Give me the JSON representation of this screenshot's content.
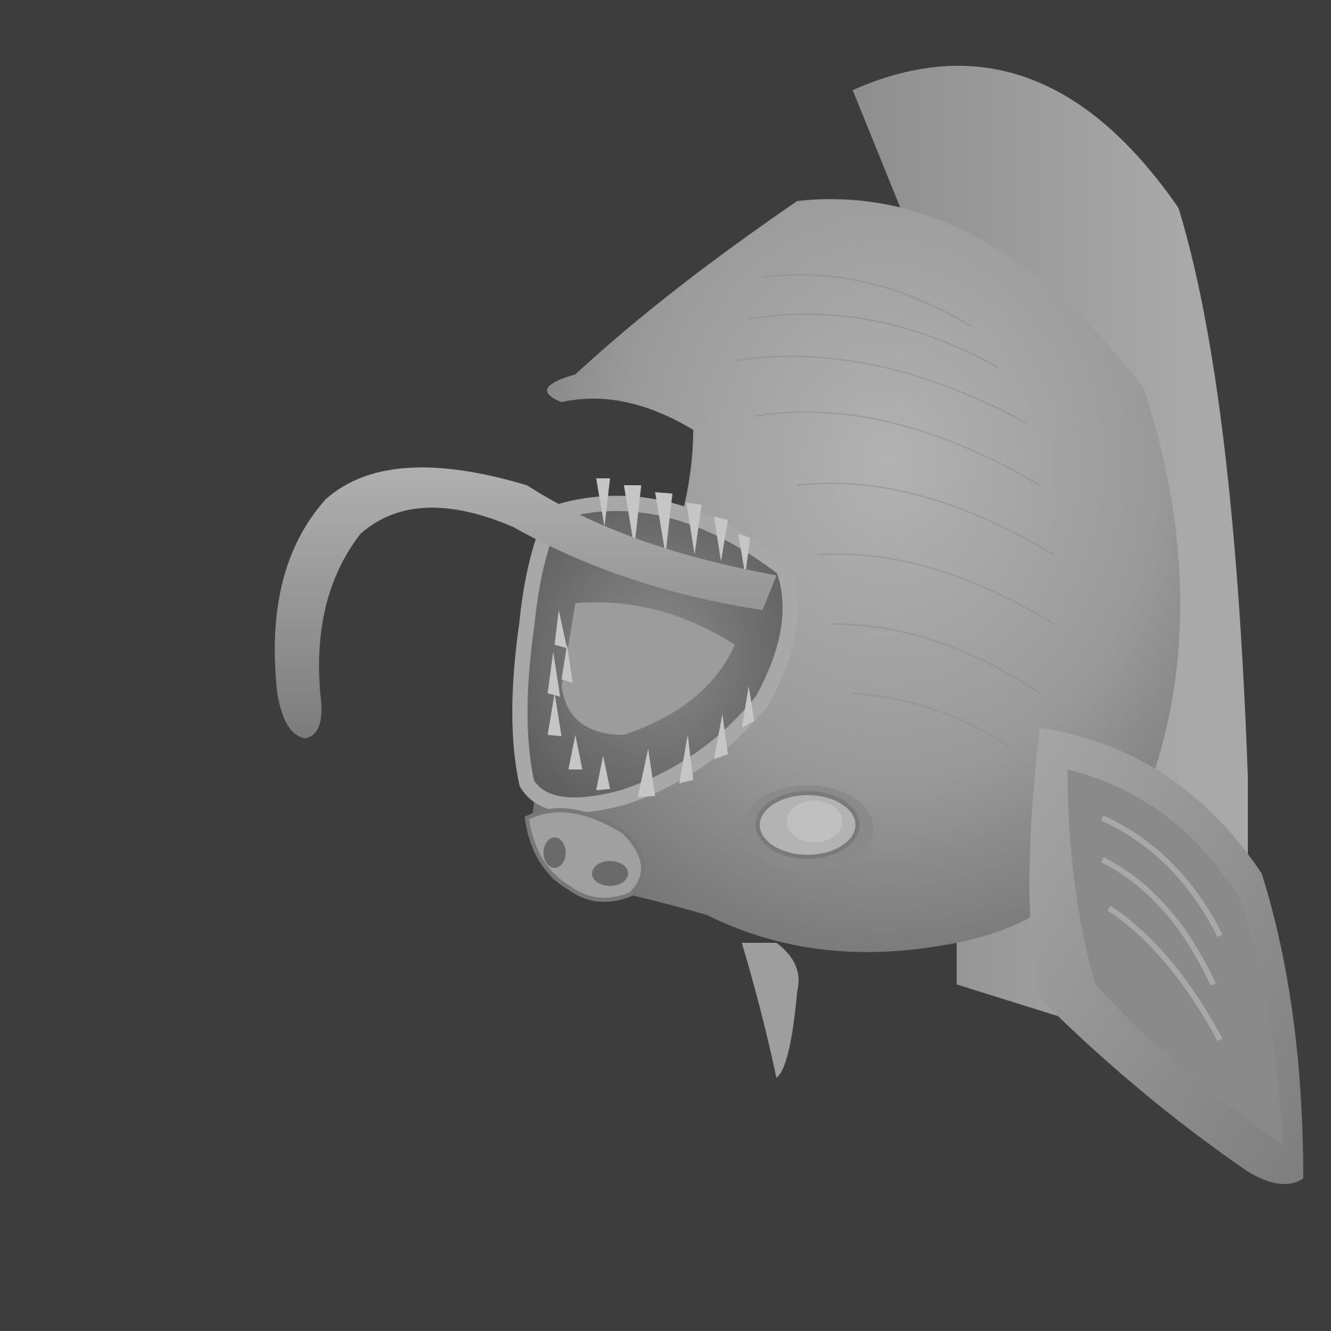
{
  "viewport": {
    "background_color": "#3d3d3d",
    "model_color": "#9a9a9a",
    "model_shadow_color": "#6e6e6e",
    "model_highlight_color": "#b4b4b4",
    "subject": "sculpted-creature-head-trophy"
  }
}
